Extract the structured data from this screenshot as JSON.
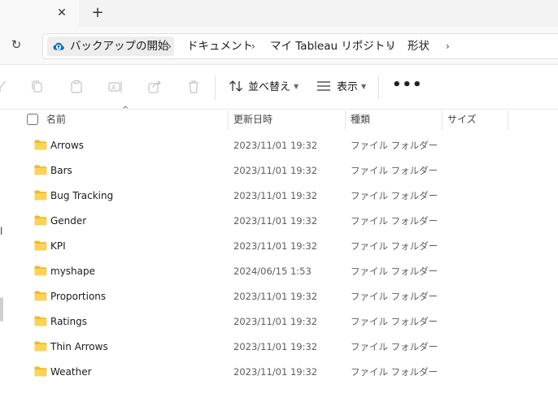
{
  "tabs": {
    "close_glyph": "✕",
    "new_tab_glyph": "+"
  },
  "address": {
    "refresh_glyph": "↻",
    "crumbs": [
      "バックアップの開始",
      "ドキュメント",
      "マイ Tableau リポジトリ",
      "形状"
    ],
    "separator": "›",
    "accent": "#0f6cbd"
  },
  "toolbar": {
    "icons": [
      "cut-icon",
      "copy-icon",
      "paste-icon",
      "rename-icon",
      "share-icon",
      "delete-icon"
    ],
    "sort_label": "並べ替え",
    "view_label": "表示",
    "more_label": "•••"
  },
  "nav": {
    "partial_text": "l"
  },
  "list": {
    "columns": {
      "name": "名前",
      "modified": "更新日時",
      "type": "種類",
      "size": "サイズ"
    },
    "sort_arrow": "^",
    "folder_color": "#f7c544",
    "items": [
      {
        "name": "Arrows",
        "modified": "2023/11/01 19:32",
        "type": "ファイル フォルダー"
      },
      {
        "name": "Bars",
        "modified": "2023/11/01 19:32",
        "type": "ファイル フォルダー"
      },
      {
        "name": "Bug Tracking",
        "modified": "2023/11/01 19:32",
        "type": "ファイル フォルダー"
      },
      {
        "name": "Gender",
        "modified": "2023/11/01 19:32",
        "type": "ファイル フォルダー"
      },
      {
        "name": "KPI",
        "modified": "2023/11/01 19:32",
        "type": "ファイル フォルダー"
      },
      {
        "name": "myshape",
        "modified": "2024/06/15 1:53",
        "type": "ファイル フォルダー"
      },
      {
        "name": "Proportions",
        "modified": "2023/11/01 19:32",
        "type": "ファイル フォルダー"
      },
      {
        "name": "Ratings",
        "modified": "2023/11/01 19:32",
        "type": "ファイル フォルダー"
      },
      {
        "name": "Thin Arrows",
        "modified": "2023/11/01 19:32",
        "type": "ファイル フォルダー"
      },
      {
        "name": "Weather",
        "modified": "2023/11/01 19:32",
        "type": "ファイル フォルダー"
      }
    ]
  }
}
